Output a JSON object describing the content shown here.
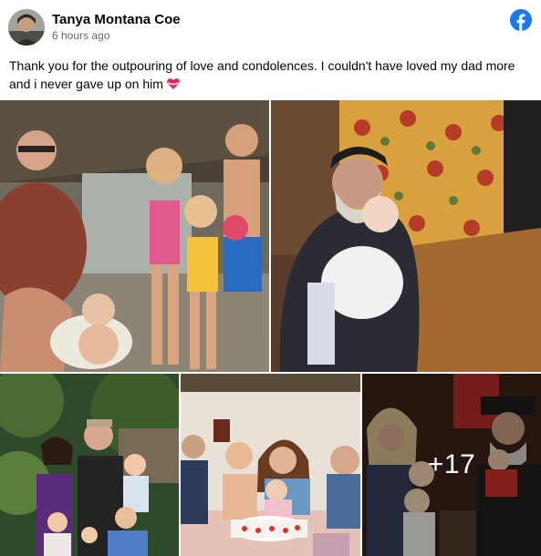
{
  "post": {
    "author": "Tanya Montana Coe",
    "timestamp": "6 hours ago",
    "caption": "Thank you for the outpouring of love and condolences. I couldn't have loved my dad more and i never gave up on him",
    "caption_emoji": "heart-with-ribbon-icon",
    "logo": "facebook-icon"
  },
  "photos": {
    "more_count": "+17",
    "items": [
      {
        "subject": "family-poolside-photo"
      },
      {
        "subject": "father-holding-baby-photo"
      },
      {
        "subject": "family-garden-photo"
      },
      {
        "subject": "birthday-cake-photo"
      },
      {
        "subject": "family-group-photo"
      }
    ]
  },
  "colors": {
    "facebook_blue": "#1877f2",
    "secondary_text": "#65676b",
    "heart_red": "#e0245e"
  }
}
